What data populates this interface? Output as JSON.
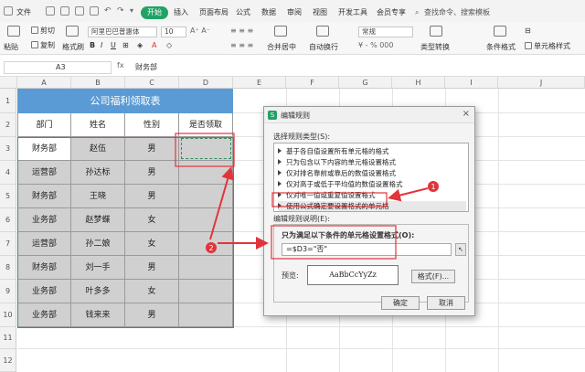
{
  "ribbon": {
    "file_menu": "文件",
    "tabs": [
      "开始",
      "插入",
      "页面布局",
      "公式",
      "数据",
      "审阅",
      "视图",
      "开发工具",
      "会员专享"
    ],
    "search": "查找命令、搜索模板"
  },
  "toolbar": {
    "paste": "粘贴",
    "cut": "剪切",
    "copy": "复制",
    "format_painter": "格式刷",
    "font_name": "阿里巴巴普惠体",
    "font_size": "10",
    "merge": "合并居中",
    "wrap": "自动换行",
    "number_format": "常规",
    "type_convert": "类型转换",
    "cond_format": "条件格式",
    "cell_style": "单元格样式"
  },
  "formula_bar": {
    "cell_ref": "A3",
    "fx": "fx",
    "content": "财务部"
  },
  "grid": {
    "col_headers": [
      "A",
      "B",
      "C",
      "D",
      "E",
      "F",
      "G",
      "H",
      "I",
      "J"
    ],
    "row_headers": [
      "1",
      "2",
      "3",
      "4",
      "5",
      "6",
      "7",
      "8",
      "9",
      "10",
      "11",
      "12"
    ],
    "table_title": "公司福利领取表",
    "headers": [
      "部门",
      "姓名",
      "性别",
      "是否领取"
    ],
    "rows": [
      [
        "财务部",
        "赵伍",
        "男",
        ""
      ],
      [
        "运营部",
        "孙达标",
        "男",
        ""
      ],
      [
        "财务部",
        "王晓",
        "男",
        ""
      ],
      [
        "业务部",
        "赵梦蝶",
        "女",
        ""
      ],
      [
        "运营部",
        "孙二娘",
        "女",
        ""
      ],
      [
        "财务部",
        "刘一手",
        "男",
        ""
      ],
      [
        "业务部",
        "叶多多",
        "女",
        ""
      ],
      [
        "业务部",
        "钱来来",
        "男",
        ""
      ]
    ]
  },
  "dialog": {
    "title": "编辑规则",
    "close": "×",
    "rule_type_label": "选择规则类型(S):",
    "rule_types": [
      "基于各自值设置所有单元格的格式",
      "只为包含以下内容的单元格设置格式",
      "仅对排名靠前或靠后的数值设置格式",
      "仅对高于或低于平均值的数值设置格式",
      "仅对唯一值或重复值设置格式",
      "使用公式确定要设置格式的单元格"
    ],
    "selected_rule": 5,
    "desc_label": "编辑规则说明(E):",
    "condition_label": "只为满足以下条件的单元格设置格式(O):",
    "formula": "=$D3=\"否\"",
    "preview_label": "预览:",
    "preview_text": "AaBbCcYyZz",
    "format_button": "格式(F)...",
    "ok": "确定",
    "cancel": "取消"
  },
  "annotations": [
    "1",
    "2"
  ],
  "colors": {
    "accent": "#21a366",
    "title_fill": "#5b9bd5",
    "highlight_gray": "#d0d0d0",
    "annotation_red": "#e0353b"
  }
}
